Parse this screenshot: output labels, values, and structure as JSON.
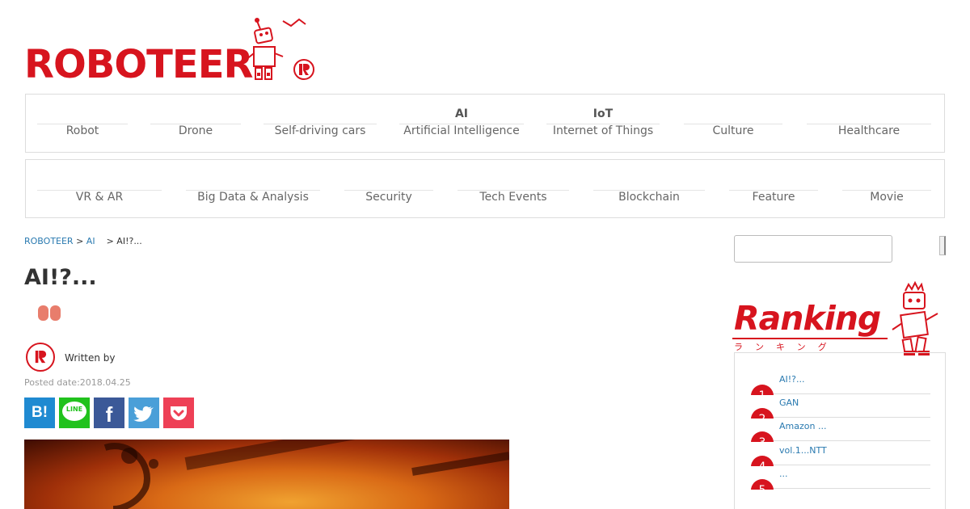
{
  "header": {
    "logo_text": "ROBOTEER"
  },
  "nav_primary": [
    {
      "abbr": "",
      "label": "Robot"
    },
    {
      "abbr": "",
      "label": "Drone"
    },
    {
      "abbr": "",
      "label": "Self-driving cars"
    },
    {
      "abbr": "AI",
      "label": "Artificial Intelligence"
    },
    {
      "abbr": "IoT",
      "label": "Internet of Things"
    },
    {
      "abbr": "",
      "label": "Culture"
    },
    {
      "abbr": "",
      "label": "Healthcare"
    }
  ],
  "nav_secondary": [
    {
      "label": "VR & AR"
    },
    {
      "label": "Big Data & Analysis"
    },
    {
      "label": "Security"
    },
    {
      "label": "Tech Events"
    },
    {
      "label": "Blockchain"
    },
    {
      "label": "Feature"
    },
    {
      "label": "Movie"
    }
  ],
  "breadcrumb": {
    "home": "ROBOTEER",
    "sep1": " > ",
    "category": "AI",
    "sep2": " > ",
    "current": "AI!?..."
  },
  "article": {
    "title": "AI!?...",
    "written_by": "Written by",
    "posted_date": "Posted date:2018.04.25"
  },
  "share": {
    "hatena": "B!",
    "line": "LINE",
    "facebook": "f"
  },
  "sidebar": {
    "search_placeholder": "",
    "ranking_title": "Ranking",
    "ranking_kana": "ランキング",
    "ranking_items": [
      {
        "rank": "1",
        "title": "AI!?..."
      },
      {
        "rank": "2",
        "title": "GAN"
      },
      {
        "rank": "3",
        "title": "Amazon ..."
      },
      {
        "rank": "4",
        "title": "vol.1...NTT"
      },
      {
        "rank": "5",
        "title": "..."
      }
    ]
  },
  "colors": {
    "brand_red": "#d7141e",
    "link_blue": "#2a7ab0"
  }
}
